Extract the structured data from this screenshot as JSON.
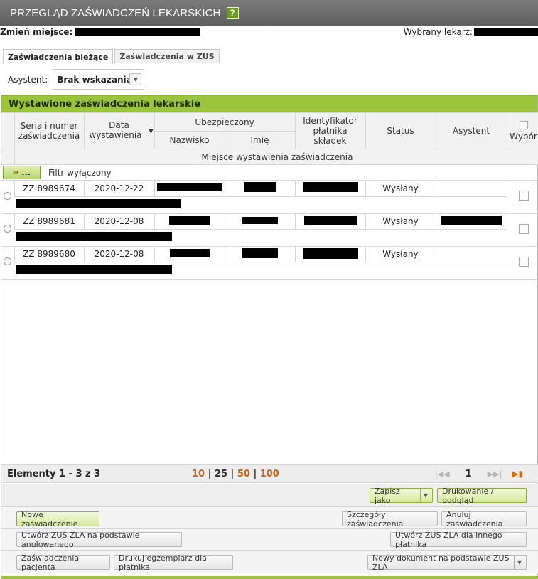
{
  "title": "PRZEGLĄD ZAŚWIADCZEŃ LEKARSKICH",
  "help_label": "?",
  "info": {
    "place_label": "Zmień miejsce:",
    "doctor_label": "Wybrany lekarz:"
  },
  "tabs": [
    {
      "label": "Zaświadczenia bieżące",
      "active": true
    },
    {
      "label": "Zaświadczenia w ZUS",
      "active": false
    }
  ],
  "assistant": {
    "label": "Asystent:",
    "value": "Brak wskazania"
  },
  "panel_title": "Wystawione zaświadczenia lekarskie",
  "columns": {
    "series": "Seria i numer zaświadczenia",
    "date": "Data wystawienia",
    "insured": "Ubezpieczony",
    "surname": "Nazwisko",
    "name": "Imię",
    "payer": "Identyfikator płatnika składek",
    "status": "Status",
    "assistant": "Asystent",
    "select": "Wybór",
    "place": "Miejsce wystawienia zaświadczenia"
  },
  "filter": {
    "button": "...",
    "label": "Filtr wyłączony"
  },
  "rows": [
    {
      "series": "ZZ 8989674",
      "date": "2020-12-22",
      "status": "Wysłany"
    },
    {
      "series": "ZZ 8989681",
      "date": "2020-12-08",
      "status": "Wysłany"
    },
    {
      "series": "ZZ 8989680",
      "date": "2020-12-08",
      "status": "Wysłany"
    }
  ],
  "pager": {
    "count": "Elementy 1 - 3 z 3",
    "sizes": [
      "10",
      "25",
      "50",
      "100"
    ],
    "separator": "|",
    "page": "1"
  },
  "buttons": {
    "save_as": "Zapisz jako",
    "print": "Drukowanie / podgląd",
    "new_cert": "Nowe zaświadczenie",
    "details": "Szczegóły zaświadczenia",
    "cancel": "Anuluj zaświadczenia",
    "zus_cancelled": "Utwórz ZUS ZLA na podstawie anulowanego",
    "zus_other": "Utwórz ZUS ZLA dla innego płatnika",
    "patient_certs": "Zaświadczenia pacjenta",
    "print_payer": "Drukuj egzemplarz dla płatnika",
    "new_doc": "Nowy dokument na podstawie ZUS ZLA"
  }
}
